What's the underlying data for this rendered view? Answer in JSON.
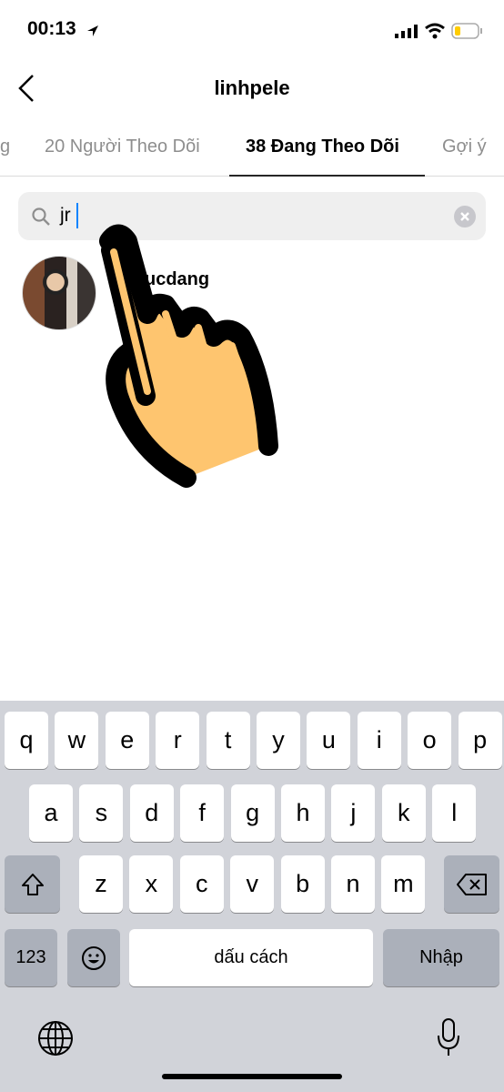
{
  "status": {
    "time": "00:13",
    "battery_color": "#ffcc00"
  },
  "header": {
    "title": "linhpele"
  },
  "tabs": [
    {
      "label": "g"
    },
    {
      "label": "20 Người Theo Dõi"
    },
    {
      "label": "38 Đang Theo Dõi",
      "active": true
    },
    {
      "label": "Gợi ý"
    }
  ],
  "search": {
    "value": "jr"
  },
  "results": [
    {
      "username": "ucdang"
    }
  ],
  "keyboard": {
    "row1": [
      "q",
      "w",
      "e",
      "r",
      "t",
      "y",
      "u",
      "i",
      "o",
      "p"
    ],
    "row2": [
      "a",
      "s",
      "d",
      "f",
      "g",
      "h",
      "j",
      "k",
      "l"
    ],
    "row3": [
      "z",
      "x",
      "c",
      "v",
      "b",
      "n",
      "m"
    ],
    "numbers": "123",
    "space": "dấu cách",
    "return": "Nhập"
  },
  "overlay": {
    "icon": "pointing-hand-icon",
    "fill": "#fec56f"
  }
}
